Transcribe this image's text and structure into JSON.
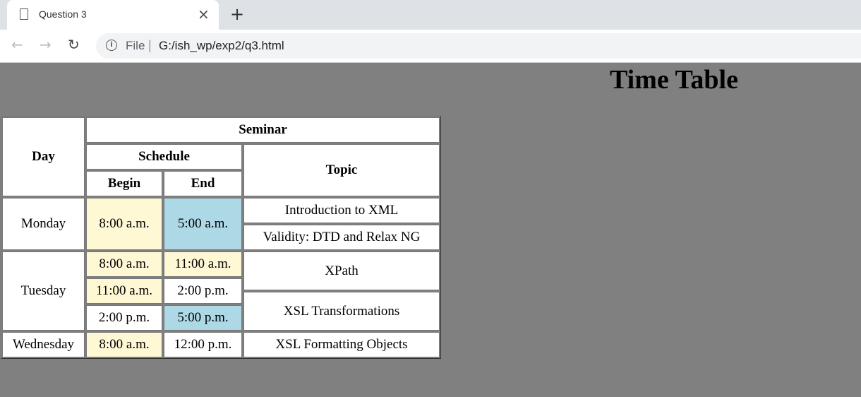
{
  "browser": {
    "tab_title": "Question 3",
    "url_scheme": "File",
    "url": "G:/ish_wp/exp2/q3.html",
    "icons": [
      "page-icon",
      "close-icon",
      "plus-icon",
      "back-icon",
      "forward-icon",
      "reload-icon",
      "info-icon"
    ]
  },
  "page": {
    "heading": "Time Table",
    "colors": {
      "background": "#808080",
      "yellow": "#fff8d4",
      "blue": "#add8e6"
    },
    "table": {
      "headers": {
        "day": "Day",
        "seminar": "Seminar",
        "schedule": "Schedule",
        "topic": "Topic",
        "begin": "Begin",
        "end": "End"
      },
      "days": [
        {
          "day": "Monday",
          "slots": [
            {
              "begin": "8:00 a.m.",
              "begin_color": "#fff8d4",
              "end": "5:00 a.m.",
              "end_color": "#add8e6"
            }
          ],
          "topics": [
            "Introduction to XML",
            "Validity: DTD and Relax NG"
          ]
        },
        {
          "day": "Tuesday",
          "slots": [
            {
              "begin": "8:00 a.m.",
              "begin_color": "#fff8d4",
              "end": "11:00 a.m.",
              "end_color": "#fff8d4"
            },
            {
              "begin": "11:00 a.m.",
              "begin_color": "#fff8d4",
              "end": "2:00 p.m.",
              "end_color": "#ffffff"
            },
            {
              "begin": "2:00 p.m.",
              "begin_color": "#ffffff",
              "end": "5:00 p.m.",
              "end_color": "#add8e6"
            }
          ],
          "topics": [
            "XPath",
            "XSL Transformations"
          ]
        },
        {
          "day": "Wednesday",
          "slots": [
            {
              "begin": "8:00 a.m.",
              "begin_color": "#fff8d4",
              "end": "12:00 p.m.",
              "end_color": "#ffffff"
            }
          ],
          "topics": [
            "XSL Formatting Objects"
          ]
        }
      ]
    }
  }
}
